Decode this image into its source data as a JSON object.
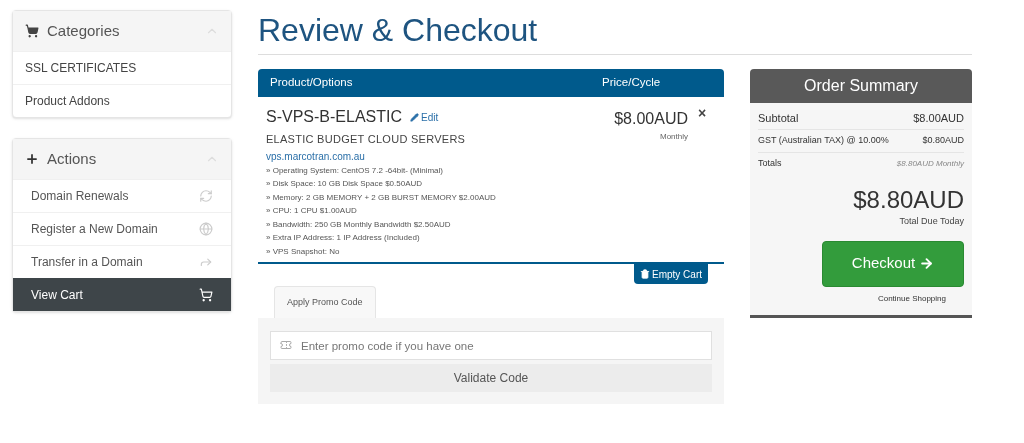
{
  "sidebar": {
    "categories": {
      "title": "Categories",
      "items": [
        "SSL CERTIFICATES",
        "Product Addons"
      ]
    },
    "actions": {
      "title": "Actions",
      "items": [
        {
          "label": "Domain Renewals",
          "selected": false
        },
        {
          "label": "Register a New Domain",
          "selected": false
        },
        {
          "label": "Transfer in a Domain",
          "selected": false
        },
        {
          "label": "View Cart",
          "selected": true
        }
      ]
    }
  },
  "page_title": "Review & Checkout",
  "cart": {
    "columns": [
      "Product/Options",
      "Price/Cycle"
    ],
    "item": {
      "name": "S-VPS-B-ELASTIC",
      "edit": "Edit",
      "group": "ELASTIC BUDGET CLOUD SERVERS",
      "domain": "vps.marcotran.com.au",
      "price": "$8.00AUD",
      "cycle": "Monthly",
      "remove": "×",
      "options": [
        "» Operating System: CentOS 7.2 -64bit- (Minimal)",
        "» Disk Space: 10 GB Disk Space $0.50AUD",
        "» Memory: 2 GB MEMORY + 2 GB BURST MEMORY $2.00AUD",
        "» CPU: 1 CPU $1.00AUD",
        "» Bandwidth: 250 GB Monthly Bandwidth $2.50AUD",
        "» Extra IP Address: 1 IP Address (Included)",
        "» VPS Snapshot: No"
      ]
    },
    "empty_button": "Empty Cart"
  },
  "promo": {
    "tab": "Apply Promo Code",
    "placeholder": "Enter promo code if you have one",
    "button": "Validate Code"
  },
  "summary": {
    "title": "Order Summary",
    "rows": [
      {
        "label": "Subtotal",
        "value": "$8.00AUD"
      },
      {
        "label": "GST (Australian TAX) @ 10.00%",
        "value": "$0.80AUD"
      }
    ],
    "totals_label": "Totals",
    "totals_value": "$8.80AUD Monthly",
    "total": "$8.80AUD",
    "total_caption": "Total Due Today",
    "checkout": "Checkout",
    "continue": "Continue Shopping"
  }
}
